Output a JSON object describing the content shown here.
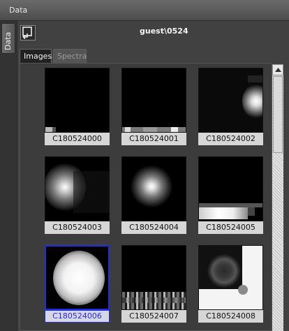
{
  "window": {
    "title": "Data"
  },
  "sidetab": {
    "label": "Data"
  },
  "header": {
    "user_path": "guest\\0524"
  },
  "tabs": [
    {
      "label": "Images",
      "active": true
    },
    {
      "label": "Spectra",
      "active": false
    }
  ],
  "thumbnails": [
    {
      "label": "C180524000"
    },
    {
      "label": "C180524001"
    },
    {
      "label": "C180524002"
    },
    {
      "label": "C180524003"
    },
    {
      "label": "C180524004"
    },
    {
      "label": "C180524005"
    },
    {
      "label": "C180524006",
      "selected": true
    },
    {
      "label": "C180524007"
    },
    {
      "label": "C180524008"
    }
  ]
}
